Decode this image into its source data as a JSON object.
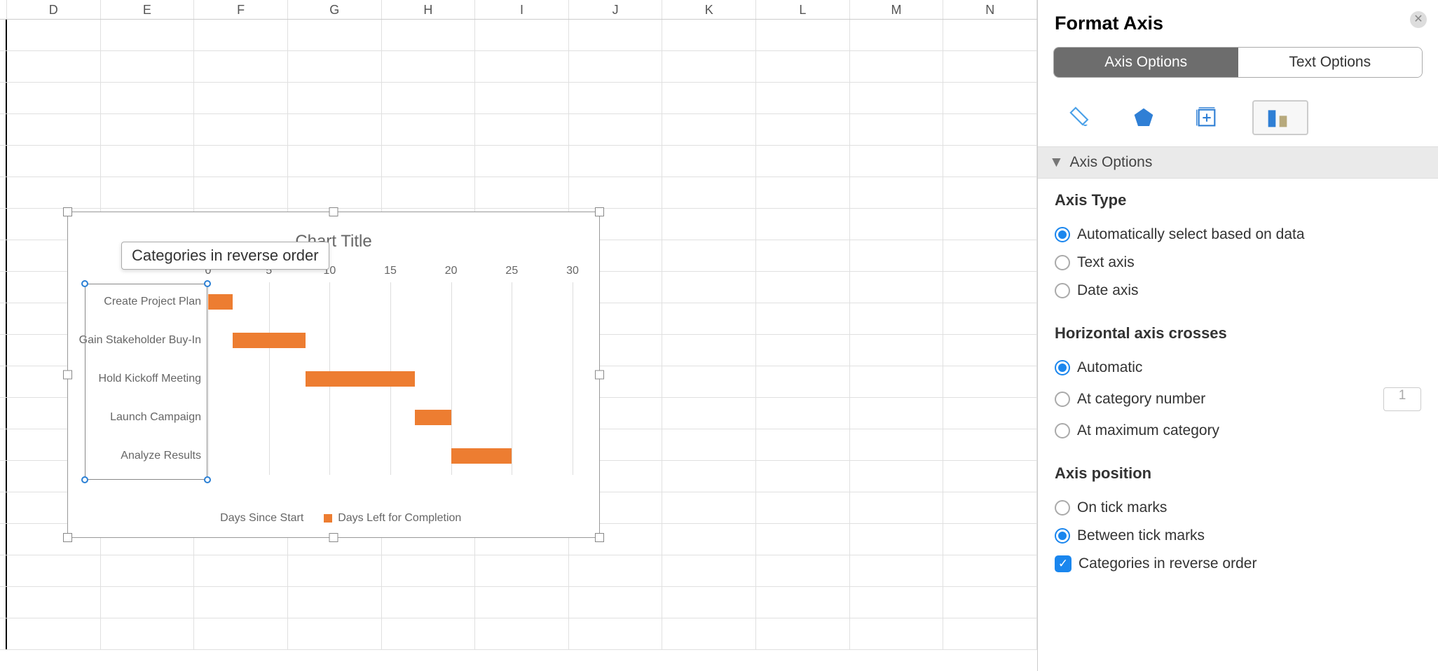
{
  "columns": [
    "D",
    "E",
    "F",
    "G",
    "H",
    "I",
    "J",
    "K",
    "L",
    "M",
    "N"
  ],
  "sidebar": {
    "title": "Format Axis",
    "tabs": {
      "axis_options": "Axis Options",
      "text_options": "Text Options"
    },
    "disclosure_label": "Axis Options",
    "axis_type": {
      "heading": "Axis Type",
      "auto": "Automatically select based on data",
      "text": "Text axis",
      "date": "Date axis"
    },
    "crosses": {
      "heading": "Horizontal axis crosses",
      "auto": "Automatic",
      "at_cat": "At category number",
      "at_cat_value": "1",
      "at_max": "At maximum category"
    },
    "position": {
      "heading": "Axis position",
      "on_ticks": "On tick marks",
      "between_ticks": "Between tick marks",
      "reverse": "Categories in reverse order"
    }
  },
  "chart_data": {
    "type": "bar",
    "title": "Chart Title",
    "tooltip": "Categories in reverse order",
    "x_axis_position": "top",
    "xlim": [
      0,
      30
    ],
    "x_ticks": [
      0,
      5,
      10,
      15,
      20,
      25,
      30
    ],
    "categories": [
      "Create Project Plan",
      "Gain Stakeholder Buy-In",
      "Hold Kickoff Meeting",
      "Launch Campaign",
      "Analyze Results"
    ],
    "series": [
      {
        "name": "Days Since Start",
        "values": [
          0,
          2,
          8,
          17,
          20
        ],
        "color": "transparent"
      },
      {
        "name": "Days Left for Completion",
        "values": [
          2,
          6,
          9,
          3,
          5
        ],
        "color": "#ED7D31"
      }
    ],
    "legend": [
      "Days Since Start",
      "Days Left for Completion"
    ]
  }
}
